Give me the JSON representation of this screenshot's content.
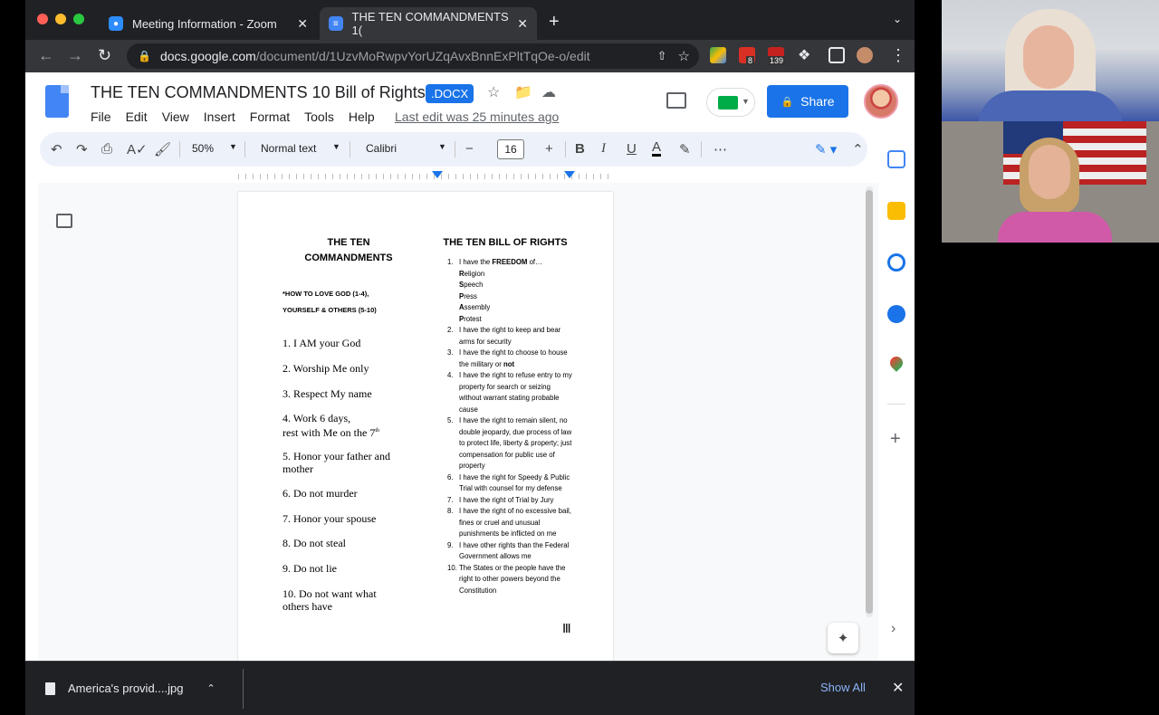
{
  "browser": {
    "tabs": [
      {
        "label": "Meeting Information - Zoom",
        "icon": "zoom-icon"
      },
      {
        "label": "THE TEN COMMANDMENTS 1(",
        "icon": "docs-icon"
      }
    ],
    "url_host": "docs.google.com",
    "url_path": "/document/d/1UzvMoRwpvYorUZqAvxBnnExPltTqOe-o/edit",
    "extension_badges": [
      "8",
      "139"
    ]
  },
  "docs": {
    "title": "THE TEN COMMANDMENTS 10 Bill of Rights",
    "badge": ".DOCX",
    "menu": [
      "File",
      "Edit",
      "View",
      "Insert",
      "Format",
      "Tools",
      "Help"
    ],
    "last_edit": "Last edit was 25 minutes ago",
    "share_label": "Share",
    "toolbar": {
      "zoom": "50%",
      "style": "Normal text",
      "font": "Calibri",
      "font_size": "16",
      "bold": "B",
      "italic": "I",
      "underline": "U",
      "text_color": "A",
      "more": "⋯"
    }
  },
  "page": {
    "left_title": "THE TEN COMMANDMENTS",
    "left_subhead_1": "*HOW TO LOVE GOD (1-4),",
    "left_subhead_2": "YOURSELF & OTHERS (5-10)",
    "commandments": [
      "1. I AM your God",
      "2. Worship Me only",
      "3. Respect My name",
      "4. Work 6 days,",
      "5. Honor your father and mother",
      "6. Do not murder",
      "7. Honor your spouse",
      "8. Do not steal",
      "9. Do not lie",
      "10. Do not want what others have"
    ],
    "commandment_4_line2": "rest with Me on the 7",
    "commandment_4_sup": "th",
    "right_title": "THE TEN BILL OF RIGHTS",
    "right1_prefix": "I have the ",
    "right1_bold": "FREEDOM",
    "right1_suffix": " of…",
    "freedoms": [
      {
        "initial": "R",
        "rest": "eligion"
      },
      {
        "initial": "S",
        "rest": "peech"
      },
      {
        "initial": "P",
        "rest": "ress"
      },
      {
        "initial": "A",
        "rest": "ssembly"
      },
      {
        "initial": "P",
        "rest": "rotest"
      }
    ],
    "rights": [
      {
        "num": "2.",
        "text": "I have the right to keep and bear arms for security"
      },
      {
        "num": "3.",
        "text": "I have the right to choose to house the military or ",
        "bold": "not"
      },
      {
        "num": "4.",
        "text": "I have the right to refuse entry to my property for search or seizing without warrant stating probable cause"
      },
      {
        "num": "5.",
        "text": "I have the right to remain silent, no double jeopardy, due process of law to protect life, liberty & property; just compensation for public use of property"
      },
      {
        "num": "6.",
        "text": "I have the right for Speedy & Public Trial with counsel for my defense"
      },
      {
        "num": "7.",
        "text": "I have the right of Trial by Jury"
      },
      {
        "num": "8.",
        "text": "I have the right of no excessive bail, fines or cruel and unusual punishments be inflicted on me"
      },
      {
        "num": "9.",
        "text": "I have other rights than the Federal Government allows me"
      },
      {
        "num": "10.",
        "text": "The States or the people have the right to other powers beyond the Constitution"
      }
    ],
    "right1_num": "1."
  },
  "downloads": {
    "file": "America's provid....jpg",
    "show_all": "Show All"
  }
}
